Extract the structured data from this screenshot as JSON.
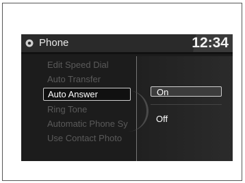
{
  "header": {
    "title": "Phone",
    "clock": "12:34"
  },
  "menu": {
    "items": [
      {
        "label": "Edit Speed Dial",
        "active": false
      },
      {
        "label": "Auto Transfer",
        "active": false
      },
      {
        "label": "Auto Answer",
        "active": true
      },
      {
        "label": "Ring Tone",
        "active": false
      },
      {
        "label": "Automatic Phone Sy",
        "active": false
      },
      {
        "label": "Use Contact Photo",
        "active": false
      }
    ]
  },
  "submenu": {
    "options": [
      {
        "label": "On",
        "selected": true
      },
      {
        "label": "Off",
        "selected": false
      }
    ]
  },
  "colors": {
    "screen_bg": "#1c1c1c",
    "highlight_border": "#cfcfcf",
    "dim_text": "#5a5a5a"
  }
}
